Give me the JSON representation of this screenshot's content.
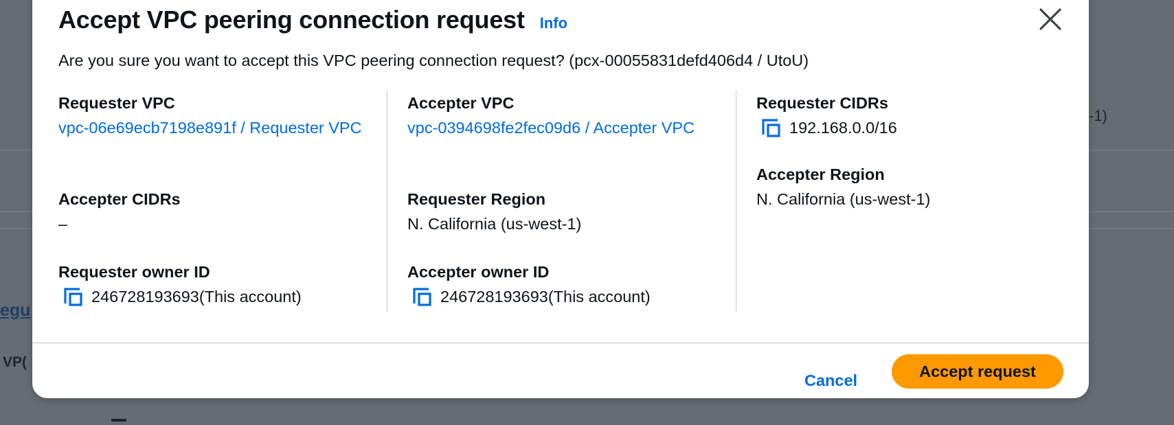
{
  "background": {
    "fragment_right": "-1)",
    "fragment_link": "egu",
    "fragment_bold": "VP("
  },
  "modal": {
    "title": "Accept VPC peering connection request",
    "info_link": "Info",
    "question": "Are you sure you want to accept this VPC peering connection request? (pcx-00055831defd406d4 / UtoU)",
    "columns": {
      "left": {
        "requester_vpc_label": "Requester VPC",
        "requester_vpc_value": "vpc-06e69ecb7198e891f / Requester VPC",
        "accepter_cidrs_label": "Accepter CIDRs",
        "accepter_cidrs_value": "–",
        "requester_owner_label": "Requester owner ID",
        "requester_owner_value": "246728193693(This account)"
      },
      "middle": {
        "accepter_vpc_label": "Accepter VPC",
        "accepter_vpc_value": "vpc-0394698fe2fec09d6 / Accepter VPC",
        "requester_region_label": "Requester Region",
        "requester_region_value": "N. California (us-west-1)",
        "accepter_owner_label": "Accepter owner ID",
        "accepter_owner_value": "246728193693(This account)"
      },
      "right": {
        "requester_cidrs_label": "Requester CIDRs",
        "requester_cidrs_value": "192.168.0.0/16",
        "accepter_region_label": "Accepter Region",
        "accepter_region_value": "N. California (us-west-1)"
      }
    },
    "buttons": {
      "cancel": "Cancel",
      "accept": "Accept request"
    }
  },
  "colors": {
    "overlay": "#676b73",
    "link": "#006ce0",
    "primary_button": "#ff9900",
    "text": "#0f141a"
  },
  "icons": [
    "close-icon",
    "copy-icon"
  ]
}
